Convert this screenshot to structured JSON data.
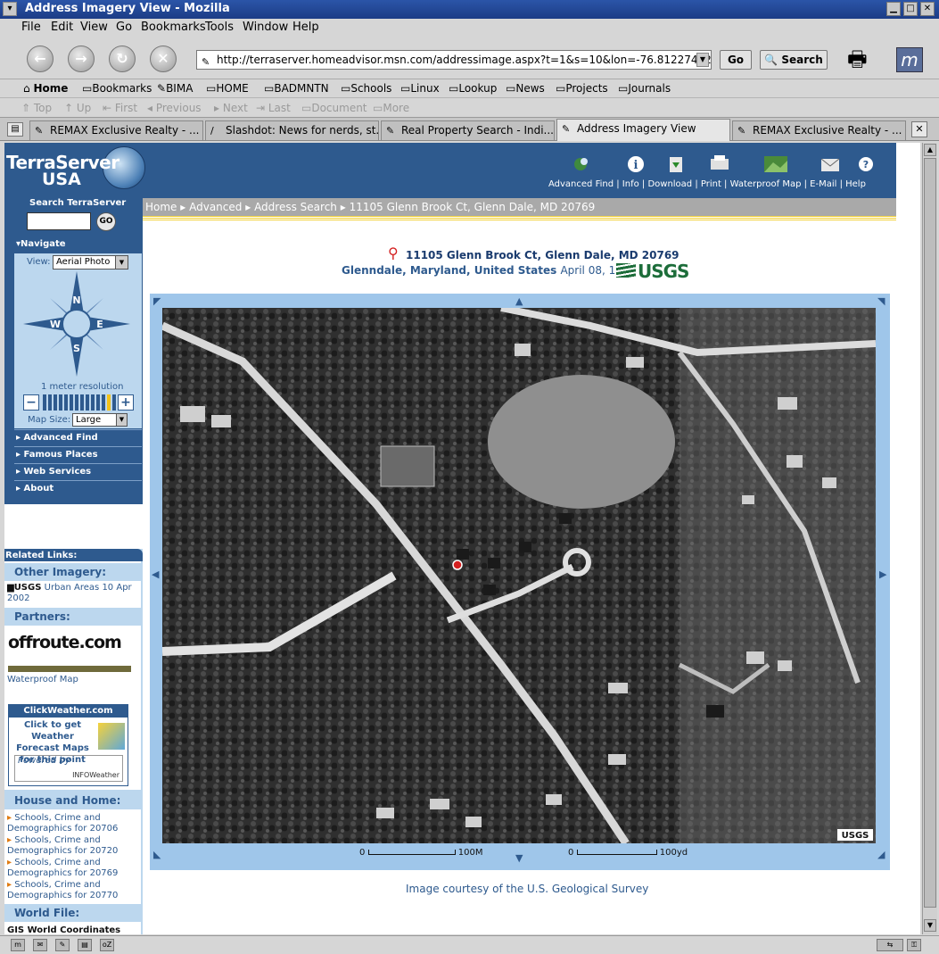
{
  "window": {
    "title": "Address Imagery View - Mozilla"
  },
  "menu": [
    "File",
    "Edit",
    "View",
    "Go",
    "Bookmarks",
    "Tools",
    "Window",
    "Help"
  ],
  "navigation": {
    "url": "http://terraserver.homeadvisor.msn.com/addressimage.aspx?t=1&s=10&lon=-76.81227452059968",
    "go_label": "Go",
    "search_label": "Search"
  },
  "personal_toolbar": [
    "Home",
    "Bookmarks",
    "BIMA",
    "HOME",
    "BADMNTN",
    "Schools",
    "Linux",
    "Lookup",
    "News",
    "Projects",
    "Journals"
  ],
  "site_nav": [
    "Top",
    "Up",
    "First",
    "Previous",
    "Next",
    "Last",
    "Document",
    "More"
  ],
  "tabs": [
    {
      "label": "REMAX Exclusive Realty - ..."
    },
    {
      "label": "Slashdot: News for nerds, st..."
    },
    {
      "label": "Real Property Search - Indi..."
    },
    {
      "label": "Address Imagery View",
      "active": true
    },
    {
      "label": "REMAX Exclusive Realty - ..."
    }
  ],
  "site": {
    "logo_line1": "TerraServer",
    "logo_line2": "USA",
    "search_label": "Search TerraServer",
    "go_label": "GO",
    "toplinks": [
      "Advanced Find",
      "Info",
      "Download",
      "Print",
      "Waterproof Map",
      "E-Mail",
      "Help"
    ],
    "toplinks_text": "Advanced Find | Info | Download | Print | Waterproof Map | E-Mail | Help",
    "breadcrumb": [
      "Home",
      "Advanced",
      "Address Search",
      "11105 Glenn Brook Ct, Glenn Dale, MD 20769"
    ]
  },
  "sidebar": {
    "navigate_label": "Navigate",
    "view_label": "View:",
    "view_value": "Aerial Photo",
    "compass": [
      "N",
      "W",
      "E",
      "S"
    ],
    "resolution": "1 meter resolution",
    "zoom_minus": "−",
    "zoom_plus": "+",
    "zoom_level": 0.93,
    "mapsize_label": "Map Size:",
    "mapsize_value": "Large",
    "items": [
      "Advanced Find",
      "Famous Places",
      "Web Services",
      "About"
    ]
  },
  "related": {
    "title": "Related Links:",
    "other_imagery": "Other Imagery:",
    "usgs_urban": "Urban Areas 10 Apr 2002",
    "partners": "Partners:",
    "offroute": "offroute.com",
    "waterproof": "Waterproof Map",
    "clickweather_title": "ClickWeather.com",
    "clickweather_text": "Click to get Weather Forecast Maps for this point",
    "powered_by": "Powered by",
    "infoweather": "INFOWeather",
    "house_home": "House and Home:",
    "schools": [
      {
        "line1": "Schools, Crime and",
        "line2": "Demographics for 20706"
      },
      {
        "line1": "Schools, Crime and",
        "line2": "Demographics for 20720"
      },
      {
        "line1": "Schools, Crime and",
        "line2": "Demographics for 20769"
      },
      {
        "line1": "Schools, Crime and",
        "line2": "Demographics for 20770"
      }
    ],
    "world_file": "World File:",
    "gis": "GIS World Coordinates"
  },
  "main": {
    "address": "11105 Glenn Brook Ct, Glenn Dale, MD 20769",
    "place": "Glenndale, Maryland, United States",
    "date": "April 08, 1993",
    "usgs": "USGS",
    "image_usgs": "USGS",
    "scale_metric_zero": "0",
    "scale_metric": "100M",
    "scale_imperial_zero": "0",
    "scale_imperial": "100yd",
    "courtesy": "Image courtesy of the U.S. Geological Survey"
  }
}
